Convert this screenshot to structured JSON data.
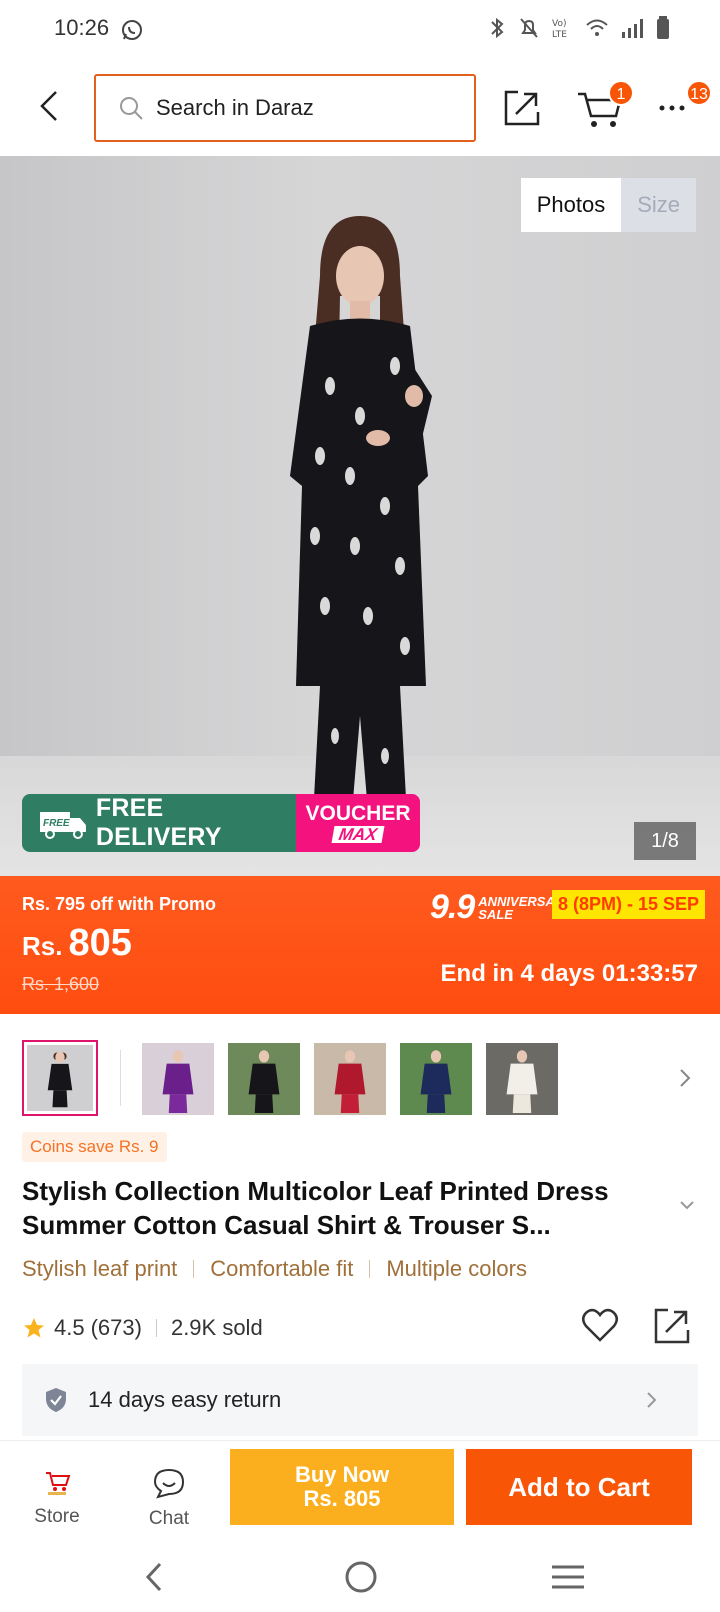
{
  "status_bar": {
    "time": "10:26"
  },
  "header": {
    "search_placeholder": "Search in Daraz",
    "cart_count": "1",
    "more_count": "13"
  },
  "gallery": {
    "tabs": [
      "Photos",
      "Size"
    ],
    "active_tab": "Photos",
    "counter": "1/8",
    "delivery_banner": {
      "free_badge": "FREE",
      "text": "FREE DELIVERY",
      "voucher_top": "VOUCHER",
      "voucher_bottom": "MAX"
    }
  },
  "promo": {
    "off_text": "Rs. 795 off with Promo",
    "currency": "Rs.",
    "price": "805",
    "old_price": "Rs. 1,600",
    "campaign_number": "9.9",
    "campaign_label": "ANNIVERSARY SALE",
    "campaign_dates": "8 (8PM) - 15 SEP",
    "countdown": "End in 4 days 01:33:57"
  },
  "thumbnails": [
    "black",
    "purple",
    "black",
    "red",
    "navy",
    "white"
  ],
  "product": {
    "coins": "Coins save Rs. 9",
    "title": "Stylish Collection Multicolor Leaf Printed Dress Summer Cotton Casual Shirt & Trouser S...",
    "tags": [
      "Stylish leaf print",
      "Comfortable fit",
      "Multiple colors"
    ],
    "rating": "4.5",
    "reviews": "(673)",
    "sold": "2.9K sold",
    "return_policy": "14 days easy return"
  },
  "actions": {
    "store": "Store",
    "chat": "Chat",
    "buy_now_line1": "Buy Now",
    "buy_now_line2": "Rs. 805",
    "add_to_cart": "Add to Cart"
  },
  "colors": {
    "brand_orange": "#f85606",
    "buy_now_yellow": "#fcaf1e",
    "delivery_green": "#2f7d63",
    "voucher_pink": "#f4127e"
  }
}
